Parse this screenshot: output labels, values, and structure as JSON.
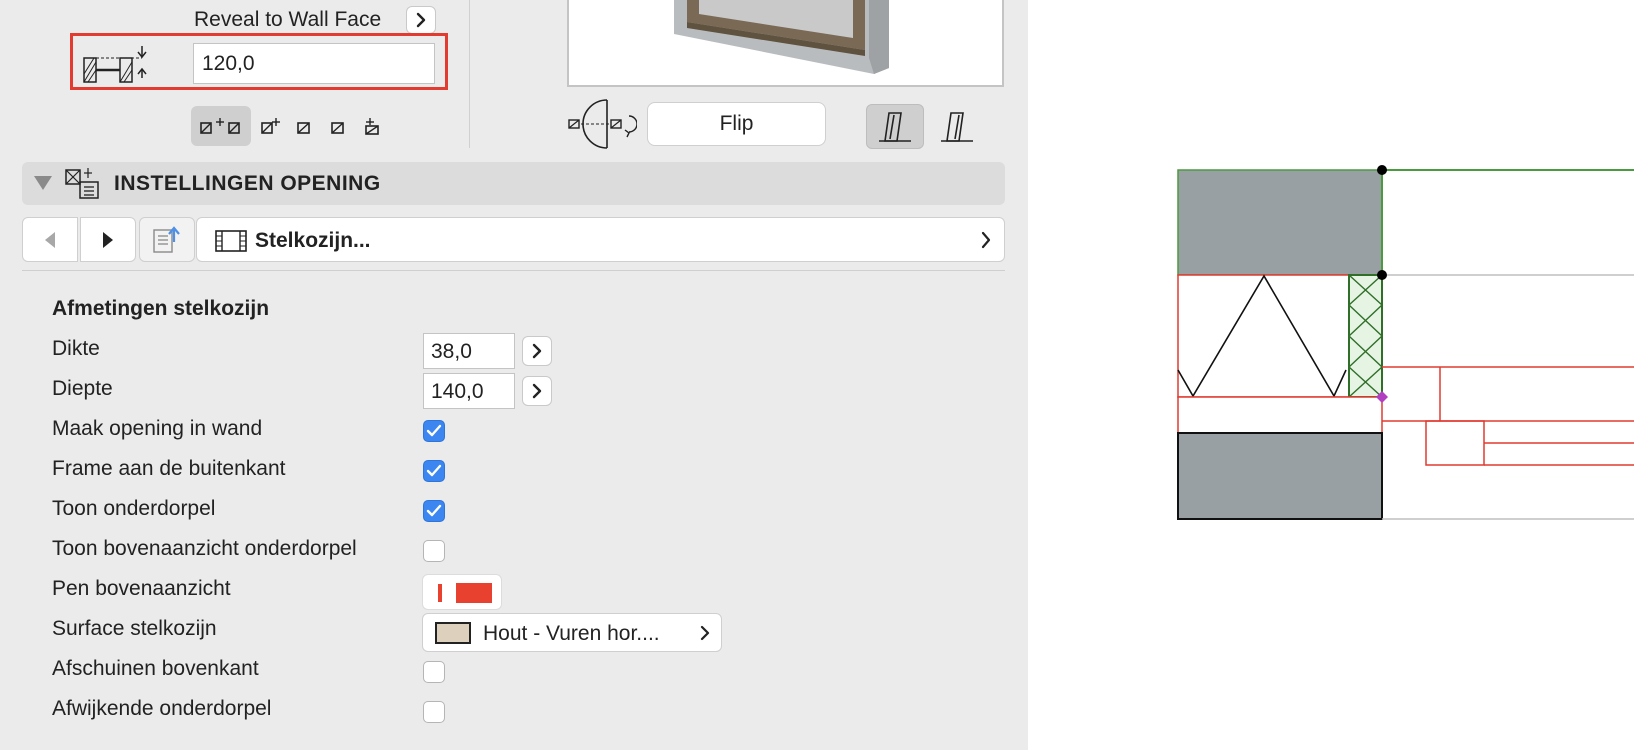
{
  "reveal": {
    "label": "Reveal to Wall Face",
    "value": "120,0"
  },
  "preview": {
    "flip_label": "Flip"
  },
  "section": {
    "title": "INSTELLINGEN OPENING"
  },
  "nav": {
    "selected_page": "Stelkozijn..."
  },
  "params": {
    "group_title": "Afmetingen stelkozijn",
    "dikte": {
      "label": "Dikte",
      "value": "38,0"
    },
    "diepte": {
      "label": "Diepte",
      "value": "140,0"
    },
    "maak_opening": {
      "label": "Maak opening in wand",
      "checked": true
    },
    "frame_buiten": {
      "label": "Frame aan de buitenkant",
      "checked": true
    },
    "toon_onderdorpel": {
      "label": "Toon onderdorpel",
      "checked": true
    },
    "toon_bovenaanzicht": {
      "label": "Toon bovenaanzicht onderdorpel",
      "checked": false
    },
    "pen_bovenaanzicht": {
      "label": "Pen bovenaanzicht",
      "pen_color": "#e8412f"
    },
    "surface": {
      "label": "Surface stelkozijn",
      "value": "Hout - Vuren hor....",
      "swatch_color": "#ddd0bd"
    },
    "afschuinen": {
      "label": "Afschuinen bovenkant",
      "checked": false
    },
    "afwijkende": {
      "label": "Afwijkende onderdorpel",
      "checked": false
    }
  },
  "colors": {
    "highlight": "#e23b2f",
    "checkbox_accent": "#3b86f0",
    "panel_bg": "#ebebeb",
    "wall_fill": "#98a0a3",
    "plan_red": "#e03a30",
    "plan_green": "#4a9a3f"
  }
}
